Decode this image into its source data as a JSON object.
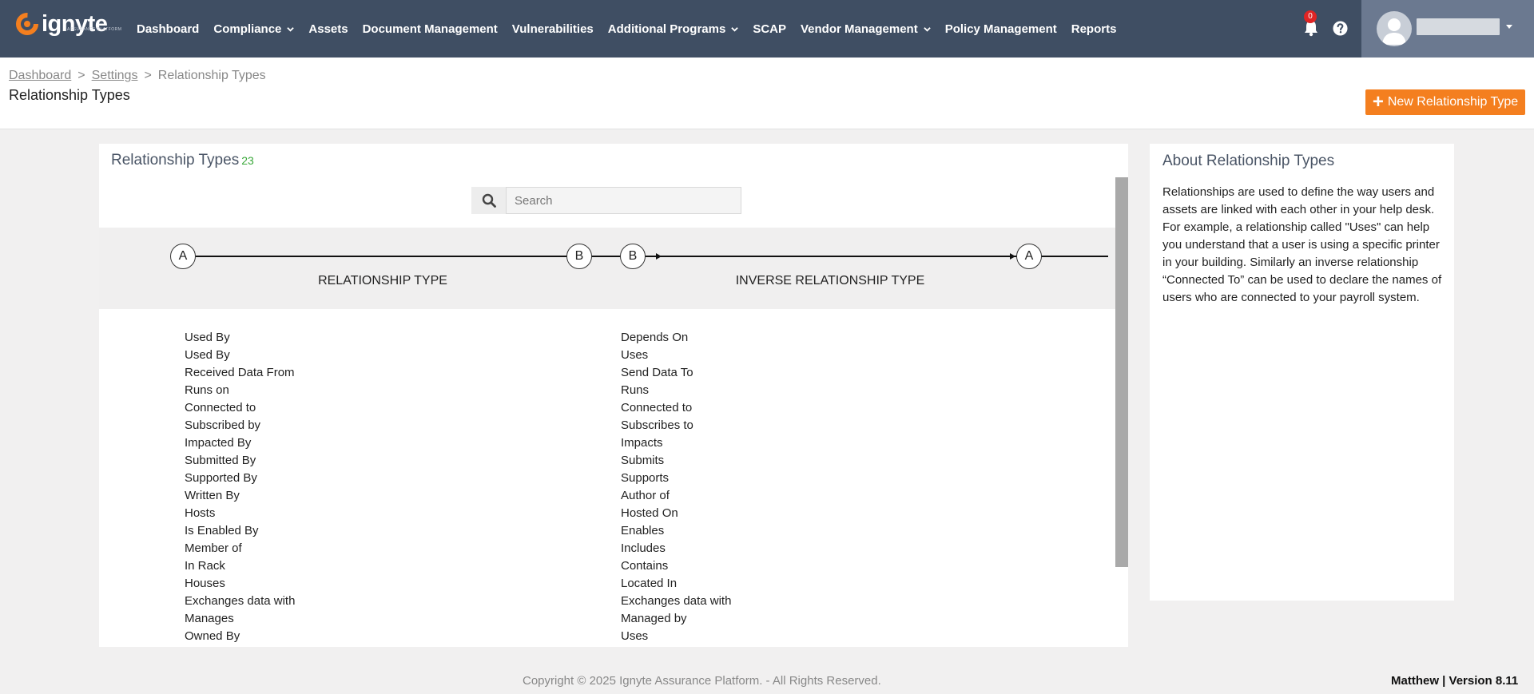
{
  "nav": {
    "logo_text": "ignyte",
    "logo_sub": "ASSURANCE PLATFORM",
    "links": [
      {
        "label": "Dashboard",
        "dropdown": false
      },
      {
        "label": "Compliance",
        "dropdown": true
      },
      {
        "label": "Assets",
        "dropdown": false
      },
      {
        "label": "Document Management",
        "dropdown": false
      },
      {
        "label": "Vulnerabilities",
        "dropdown": false
      },
      {
        "label": "Additional Programs",
        "dropdown": true
      },
      {
        "label": "SCAP",
        "dropdown": false
      },
      {
        "label": "Vendor Management",
        "dropdown": true
      },
      {
        "label": "Policy Management",
        "dropdown": false
      },
      {
        "label": "Reports",
        "dropdown": false
      }
    ],
    "notification_count": "0",
    "icons": {
      "notifications": "bell-icon",
      "help": "help-icon",
      "user": "avatar-icon"
    }
  },
  "breadcrumb": {
    "items": [
      "Dashboard",
      "Settings",
      "Relationship Types"
    ],
    "separator": ">"
  },
  "page_title": "Relationship Types",
  "new_button_label": "New Relationship Type",
  "main": {
    "title": "Relationship Types",
    "count": "23",
    "search_placeholder": "Search",
    "diagram": {
      "left": {
        "from": "A",
        "to": "B",
        "label": "RELATIONSHIP TYPE"
      },
      "right": {
        "from": "B",
        "to": "A",
        "label": "INVERSE RELATIONSHIP TYPE"
      }
    },
    "relationships": [
      "Used By",
      "Used By",
      "Received Data From",
      "Runs on",
      "Connected to",
      "Subscribed by",
      "Impacted By",
      "Submitted By",
      "Supported By",
      "Written By",
      "Hosts",
      "Is Enabled By",
      "Member of",
      "In Rack",
      "Houses",
      "Exchanges data with",
      "Manages",
      "Owned By"
    ],
    "inverse_relationships": [
      "Depends On",
      "Uses",
      "Send Data To",
      "Runs",
      "Connected to",
      "Subscribes to",
      "Impacts",
      "Submits",
      "Supports",
      "Author of",
      "Hosted On",
      "Enables",
      "Includes",
      "Contains",
      "Located In",
      "Exchanges data with",
      "Managed by",
      "Uses"
    ]
  },
  "about": {
    "title": "About Relationship Types",
    "text": "Relationships are used to define the way users and assets are linked with each other in your help desk. For example, a relationship called \"Uses\" can help you understand that a user is using a specific printer in your building. Similarly an inverse relationship “Connected To” can be used to declare the names of users who are connected to your payroll system."
  },
  "footer": {
    "copyright": "Copyright © 2025 Ignyte Assurance Platform. - All Rights Reserved.",
    "version": "Matthew | Version 8.11"
  },
  "colors": {
    "nav_bg": "#3f4e63",
    "user_area_bg": "#6b7990",
    "accent_orange": "#f47f1f",
    "count_green": "#3aa83a",
    "badge_red": "#e02424"
  }
}
